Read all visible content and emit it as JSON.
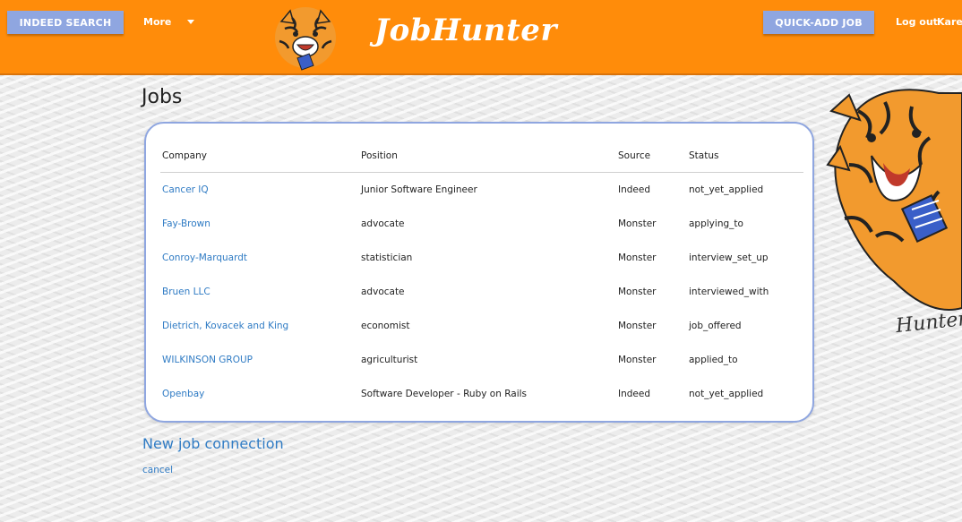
{
  "header": {
    "indeed_search": "INDEED SEARCH",
    "more": "More",
    "brand": "JobHunter",
    "quick_add": "QUICK-ADD JOB",
    "logout": "Log out",
    "user": "Karen"
  },
  "page": {
    "title": "Jobs",
    "new_connection": "New job connection",
    "cancel": "cancel",
    "art_signature": "Hunter"
  },
  "table": {
    "headers": [
      "Company",
      "Position",
      "Source",
      "Status"
    ],
    "rows": [
      {
        "company": "Cancer IQ",
        "position": "Junior Software Engineer",
        "source": "Indeed",
        "status": "not_yet_applied"
      },
      {
        "company": "Fay-Brown",
        "position": "advocate",
        "source": "Monster",
        "status": "applying_to"
      },
      {
        "company": "Conroy-Marquardt",
        "position": "statistician",
        "source": "Monster",
        "status": "interview_set_up"
      },
      {
        "company": "Bruen LLC",
        "position": "advocate",
        "source": "Monster",
        "status": "interviewed_with"
      },
      {
        "company": "Dietrich, Kovacek and King",
        "position": "economist",
        "source": "Monster",
        "status": "job_offered"
      },
      {
        "company": "WILKINSON GROUP",
        "position": "agriculturist",
        "source": "Monster",
        "status": "applied_to"
      },
      {
        "company": "Openbay",
        "position": "Software Developer - Ruby on Rails",
        "source": "Indeed",
        "status": "not_yet_applied"
      }
    ]
  },
  "colors": {
    "header_bg": "#ff8c0a",
    "button_bg": "#8fa6e0",
    "link": "#2f7bc4"
  }
}
